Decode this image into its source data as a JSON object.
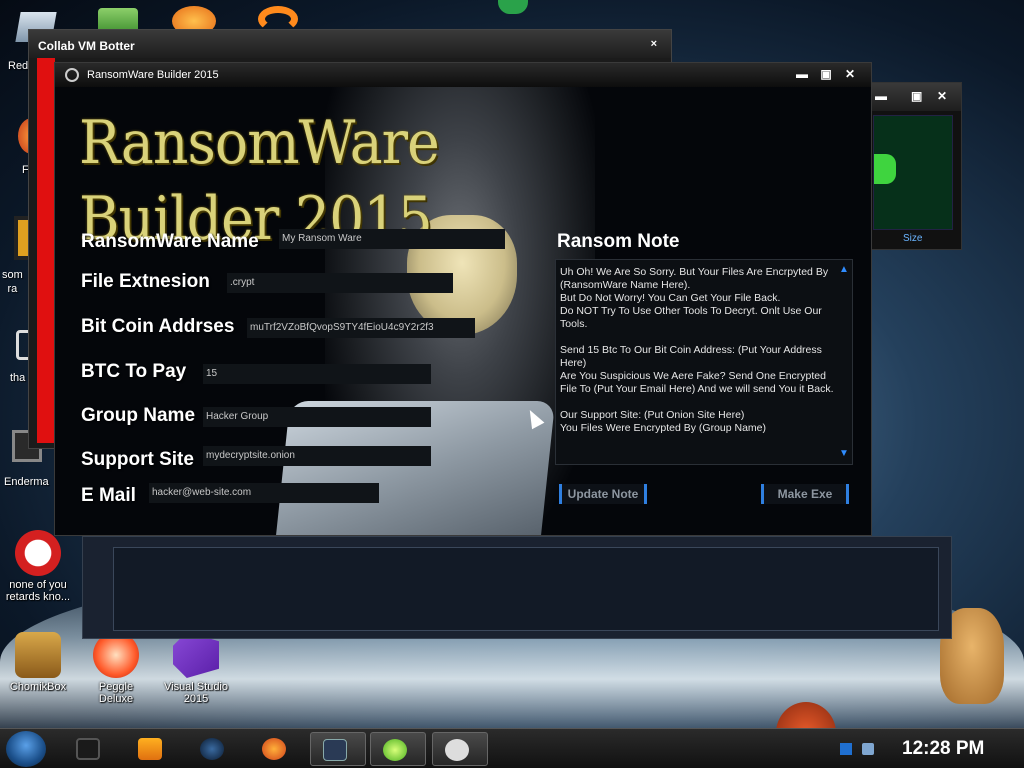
{
  "desktop": {
    "icons_left_partial": [
      {
        "label": "Red"
      },
      {
        "label": "F"
      },
      {
        "label": "som\nra"
      },
      {
        "label": "tha"
      },
      {
        "label": "Enderma"
      }
    ],
    "icons": [
      {
        "label": "none of you\nretards kno..."
      },
      {
        "label": "ChomikBox"
      },
      {
        "label": "Peggle\nDeluxe"
      },
      {
        "label": "Visual Studio\n2015"
      }
    ]
  },
  "collab_window": {
    "title": "Collab VM Botter",
    "close": "×"
  },
  "right_window": {
    "size_button": "Size"
  },
  "builder": {
    "title": "RansomWare Builder 2015",
    "logo": "RansomWare Builder 2015",
    "controls": {
      "minimize": "▬",
      "maximize": "▣",
      "close": "✕"
    },
    "fields": [
      {
        "label": "RansomWare Name",
        "value": "My Ransom Ware"
      },
      {
        "label": "File Extnesion",
        "value": ".crypt"
      },
      {
        "label": "Bit Coin Addrses",
        "value": "muTrf2VZoBfQvopS9TY4fEioU4c9Y2r2f3"
      },
      {
        "label": "BTC To Pay",
        "value": "15"
      },
      {
        "label": "Group Name",
        "value": "Hacker Group"
      },
      {
        "label": "Support Site",
        "value": "mydecryptsite.onion"
      },
      {
        "label": "E Mail",
        "value": "hacker@web-site.com"
      }
    ],
    "note_label": "Ransom Note",
    "note_text": "Uh Oh! We Are So Sorry. But Your Files Are Encrpyted By (RansomWare Name Here).\nBut Do Not Worry! You Can Get Your File Back.\nDo NOT Try To Use Other Tools To Decryt. Onlt Use Our Tools.\n\nSend 15 Btc To Our Bit Coin Address: (Put Your Address Here)\nAre You Suspicious We Aere Fake? Send One Encrypted File To (Put Your Email Here) And we will send You it Back.\n\nOur Support Site: (Put Onion Site Here)\nYou Files Were Encrypted By (Group Name)",
    "update_button": "Update Note",
    "make_button": "Make Exe"
  },
  "taskbar": {
    "clock": "12:28 PM"
  }
}
